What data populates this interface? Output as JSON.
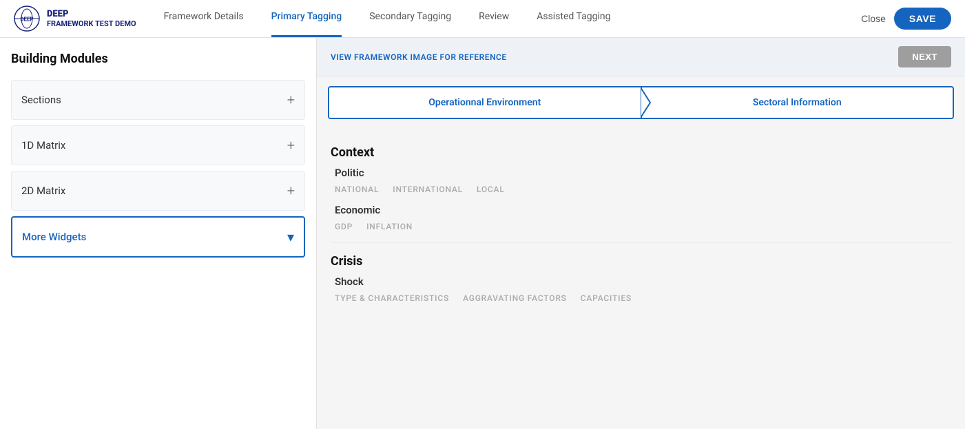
{
  "header": {
    "logo_name": "DEEP",
    "project_name": "FRAMEWORK TEST DEMO",
    "nav": [
      {
        "label": "Framework Details",
        "active": false
      },
      {
        "label": "Primary Tagging",
        "active": true
      },
      {
        "label": "Secondary Tagging",
        "active": false
      },
      {
        "label": "Review",
        "active": false
      },
      {
        "label": "Assisted Tagging",
        "active": false
      }
    ],
    "close_label": "Close",
    "save_label": "SAVE"
  },
  "sidebar": {
    "title": "Building Modules",
    "items": [
      {
        "label": "Sections",
        "expanded": false,
        "icon_plus": "+"
      },
      {
        "label": "1D Matrix",
        "expanded": false,
        "icon_plus": "+"
      },
      {
        "label": "2D Matrix",
        "expanded": false,
        "icon_plus": "+"
      },
      {
        "label": "More Widgets",
        "expanded": true,
        "icon_chevron": "▾"
      }
    ]
  },
  "content": {
    "view_framework_link": "VIEW FRAMEWORK IMAGE FOR REFERENCE",
    "next_btn": "NEXT",
    "tabs": [
      {
        "label": "Operationnal Environment",
        "active": true
      },
      {
        "label": "Sectoral Information",
        "active": false
      }
    ],
    "sections": [
      {
        "heading": "Context",
        "sub_sections": [
          {
            "sub_heading": "Politic",
            "tags": [
              "NATIONAL",
              "INTERNATIONAL",
              "LOCAL"
            ]
          },
          {
            "sub_heading": "Economic",
            "tags": [
              "GDP",
              "INFLATION"
            ]
          }
        ]
      },
      {
        "heading": "Crisis",
        "sub_sections": [
          {
            "sub_heading": "Shock",
            "tags": [
              "TYPE & CHARACTERISTICS",
              "AGGRAVATING FACTORS",
              "CAPACITIES"
            ]
          }
        ]
      }
    ]
  }
}
